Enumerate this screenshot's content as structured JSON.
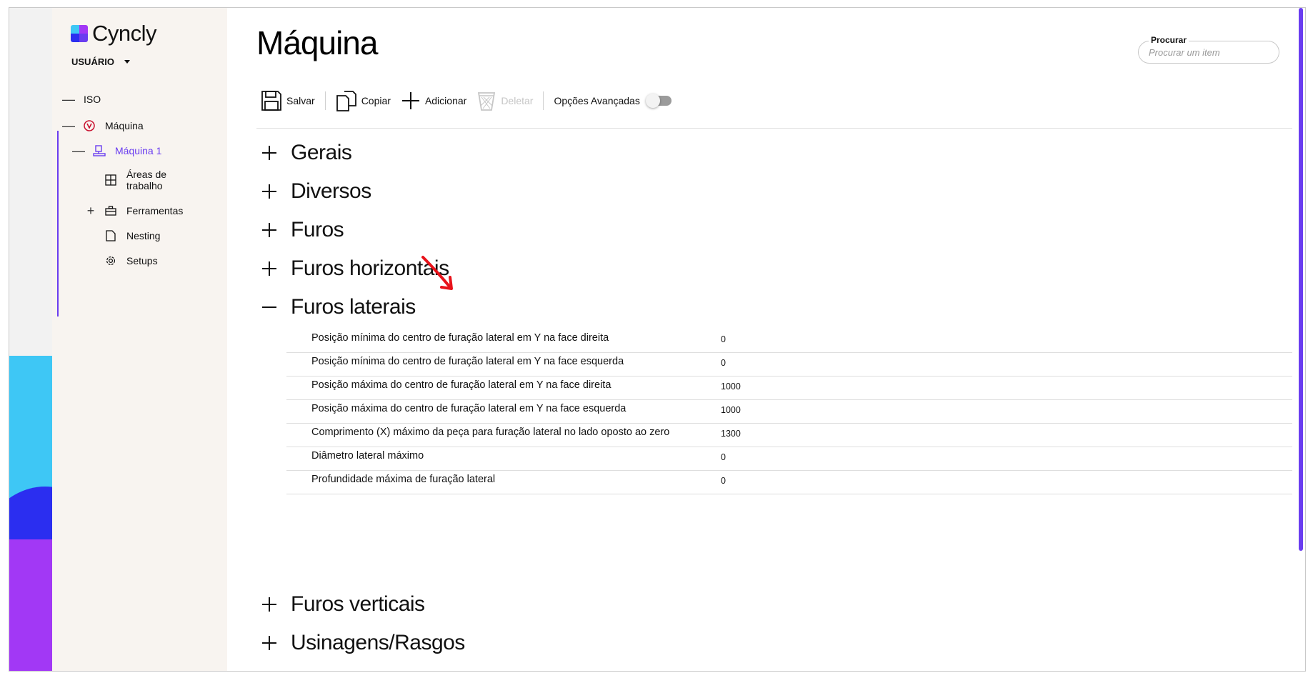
{
  "app": {
    "brand": "Cyncly",
    "user_label": "USUÁRIO"
  },
  "sidebar": {
    "items": [
      {
        "label": "ISO",
        "expander": "—",
        "icon": "none"
      },
      {
        "label": "Máquina",
        "expander": "—",
        "icon": "machine-logo-icon"
      },
      {
        "label": "Máquina 1",
        "expander": "—",
        "icon": "machine-icon"
      },
      {
        "label": "Áreas de trabalho",
        "expander": "",
        "icon": "grid-icon"
      },
      {
        "label": "Ferramentas",
        "expander": "+",
        "icon": "toolbox-icon"
      },
      {
        "label": "Nesting",
        "expander": "",
        "icon": "document-icon"
      },
      {
        "label": "Setups",
        "expander": "",
        "icon": "gear-icon"
      }
    ]
  },
  "page": {
    "title": "Máquina"
  },
  "search": {
    "label": "Procurar",
    "placeholder": "Procurar um item"
  },
  "toolbar": {
    "save": "Salvar",
    "copy": "Copiar",
    "add": "Adicionar",
    "delete": "Deletar",
    "advanced": "Opções Avançadas",
    "advanced_enabled": false
  },
  "sections": [
    {
      "label": "Gerais",
      "expanded": false
    },
    {
      "label": "Diversos",
      "expanded": false
    },
    {
      "label": "Furos",
      "expanded": false
    },
    {
      "label": "Furos horizontais",
      "expanded": false
    },
    {
      "label": "Furos laterais",
      "expanded": true
    },
    {
      "label": "Furos verticais",
      "expanded": false
    },
    {
      "label": "Usinagens/Rasgos",
      "expanded": false
    }
  ],
  "properties": [
    {
      "label": "Posição mínima do centro de furação lateral em Y na face direita",
      "value": "0"
    },
    {
      "label": "Posição mínima do centro de furação lateral em Y na face esquerda",
      "value": "0"
    },
    {
      "label": "Posição máxima do centro de furação lateral em Y na face direita",
      "value": "1000"
    },
    {
      "label": "Posição máxima do centro de furação lateral em Y na face esquerda",
      "value": "1000"
    },
    {
      "label": "Comprimento (X) máximo da peça para furação lateral no lado oposto ao zero",
      "value": "1300"
    },
    {
      "label": "Diâmetro lateral máximo",
      "value": "0"
    },
    {
      "label": "Profundidade máxima de furação lateral",
      "value": "0"
    }
  ],
  "colors": {
    "accent": "#6a3df0",
    "annotation": "#e8121a"
  }
}
